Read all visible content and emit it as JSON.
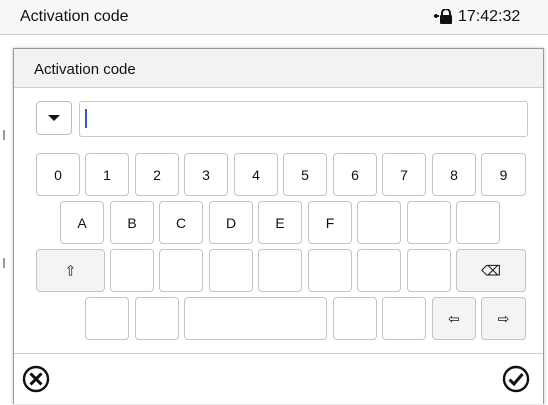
{
  "statusbar": {
    "title": "Activation code",
    "time": "17:42:32",
    "icon": "lock-icon"
  },
  "dialog": {
    "title": "Activation code",
    "input_value": ""
  },
  "keyboard": {
    "row1": [
      "0",
      "1",
      "2",
      "3",
      "4",
      "5",
      "6",
      "7",
      "8",
      "9"
    ],
    "row2": [
      "A",
      "B",
      "C",
      "D",
      "E",
      "F",
      "",
      "",
      ""
    ],
    "shift": "⇧",
    "backspace": "⌫",
    "left": "⇦",
    "right": "⇨"
  },
  "footer": {
    "cancel_icon": "cancel-icon",
    "confirm_icon": "confirm-icon"
  }
}
